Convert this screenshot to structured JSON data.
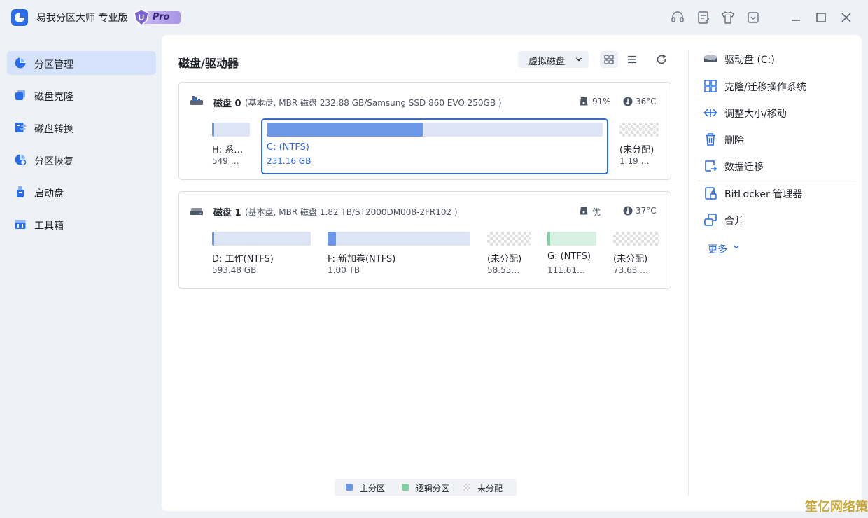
{
  "titlebar": {
    "app_title": "易我分区大师 专业版",
    "badge_letter": "U",
    "badge_text": "Pro"
  },
  "sidebar": {
    "items": [
      {
        "label": "分区管理",
        "icon": "pie-chart-icon",
        "active": true
      },
      {
        "label": "磁盘克隆",
        "icon": "clone-icon",
        "active": false
      },
      {
        "label": "磁盘转换",
        "icon": "convert-icon",
        "active": false
      },
      {
        "label": "分区恢复",
        "icon": "recovery-icon",
        "active": false
      },
      {
        "label": "启动盘",
        "icon": "usb-icon",
        "active": false
      },
      {
        "label": "工具箱",
        "icon": "toolbox-icon",
        "active": false
      }
    ]
  },
  "content": {
    "title": "磁盘/驱动器",
    "virtual_disk_label": "虚拟磁盘"
  },
  "disks": [
    {
      "name": "磁盘 0",
      "info": "(基本盘, MBR 磁盘 232.88 GB/Samsung SSD 860 EVO 250GB )",
      "health": "91%",
      "temp": "36°C",
      "partitions": [
        {
          "name": "H: 系…",
          "size": "549 …",
          "type": "primary",
          "used": 0.05
        },
        {
          "name": "C: (NTFS)",
          "size": "231.16 GB",
          "type": "primary",
          "used": 0.46,
          "selected": true
        },
        {
          "name": "(未分配)",
          "size": "1.19 …",
          "type": "unallocated",
          "used": 0
        }
      ]
    },
    {
      "name": "磁盘 1",
      "info": "(基本盘, MBR 磁盘 1.82 TB/ST2000DM008-2FR102 )",
      "health": "优",
      "temp": "37°C",
      "partitions": [
        {
          "name": "D: 工作(NTFS)",
          "size": "593.48 GB",
          "type": "primary",
          "used": 0.02
        },
        {
          "name": "F: 新加卷(NTFS)",
          "size": "1.00 TB",
          "type": "primary",
          "used": 0.06
        },
        {
          "name": "(未分配)",
          "size": "58.55…",
          "type": "unallocated",
          "used": 0
        },
        {
          "name": "G: (NTFS)",
          "size": "111.61…",
          "type": "logical",
          "used": 0.05
        },
        {
          "name": "(未分配)",
          "size": "73.63 …",
          "type": "unallocated",
          "used": 0
        }
      ]
    }
  ],
  "legend": [
    {
      "label": "主分区",
      "color": "#6b97e6"
    },
    {
      "label": "逻辑分区",
      "color": "#7fcfa3"
    },
    {
      "label": "未分配",
      "color": "#e0e0e0"
    }
  ],
  "actions": {
    "drive": "驱动盘 (C:)",
    "items": [
      {
        "label": "克隆/迁移操作系统",
        "icon": "clone-os-icon"
      },
      {
        "label": "调整大小/移动",
        "icon": "resize-icon"
      },
      {
        "label": "删除",
        "icon": "trash-icon"
      },
      {
        "label": "数据迁移",
        "icon": "data-migrate-icon"
      },
      {
        "label": "BitLocker 管理器",
        "icon": "bitlocker-icon"
      },
      {
        "label": "合并",
        "icon": "merge-icon"
      }
    ],
    "more": "更多"
  },
  "watermark": "笙亿网络策划",
  "colors": {
    "accent": "#2b6de8",
    "primary_partition": "#6b97e6",
    "logical_partition": "#7fcfa3",
    "sidebar_active": "#d5e2f9"
  }
}
